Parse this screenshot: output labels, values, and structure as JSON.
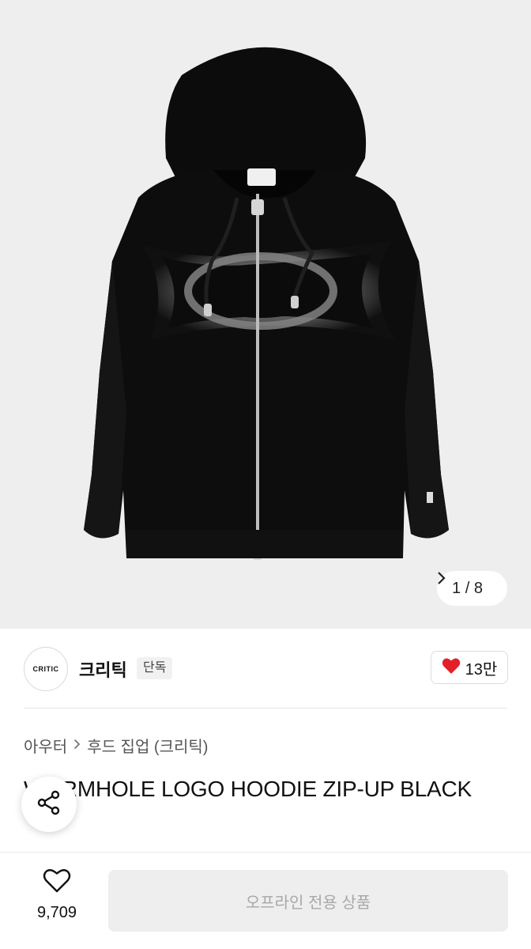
{
  "gallery": {
    "pager_text": "1 / 8",
    "next_icon": "chevron-right-icon"
  },
  "brand": {
    "logo_text": "CRITIC",
    "name": "크리틱",
    "tag": "단독",
    "likes": "13만",
    "like_icon": "heart-icon",
    "like_color": "#e3202a"
  },
  "product": {
    "category": "아우터",
    "subcategory": "후드 집업 (크리틱)",
    "title": "WORMHOLE LOGO HOODIE ZIP-UP BLACK"
  },
  "bottom_bar": {
    "wish_count": "9,709",
    "buy_label": "오프라인 전용 상품"
  }
}
